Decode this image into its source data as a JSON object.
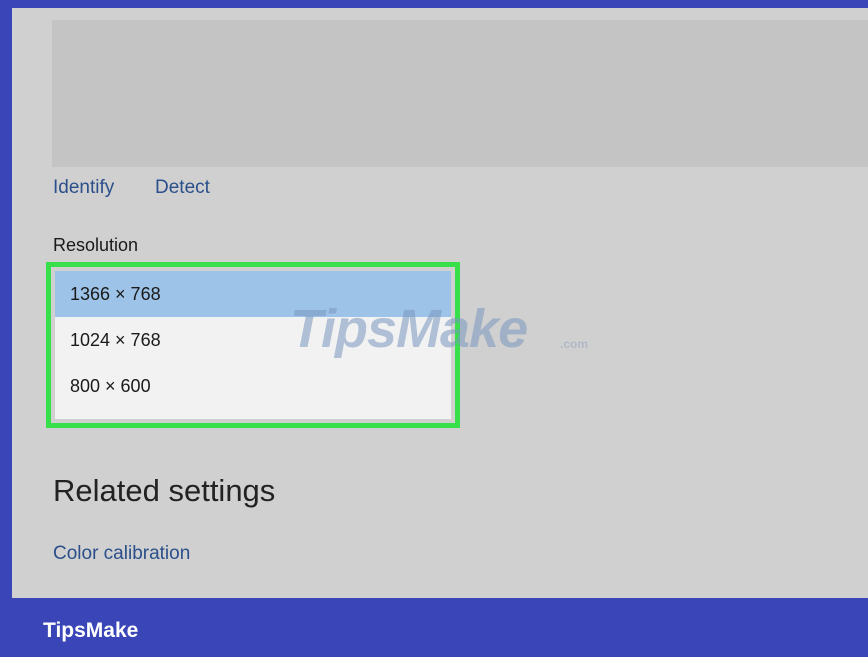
{
  "display": {
    "links": {
      "identify": "Identify",
      "detect": "Detect"
    },
    "resolution": {
      "label": "Resolution",
      "options": [
        "1366 × 768",
        "1024 × 768",
        "800 × 600"
      ],
      "selected_index": 0
    },
    "related": {
      "heading": "Related settings",
      "color_calibration": "Color calibration"
    }
  },
  "watermark": {
    "text": "TipsMake",
    "suffix": ".com"
  },
  "footer": {
    "brand": "TipsMake"
  },
  "colors": {
    "frame_blue": "#3a46b8",
    "highlight_green": "#37e04a",
    "selected_blue": "#9ec3e8",
    "link_blue": "#2b4f8a"
  }
}
